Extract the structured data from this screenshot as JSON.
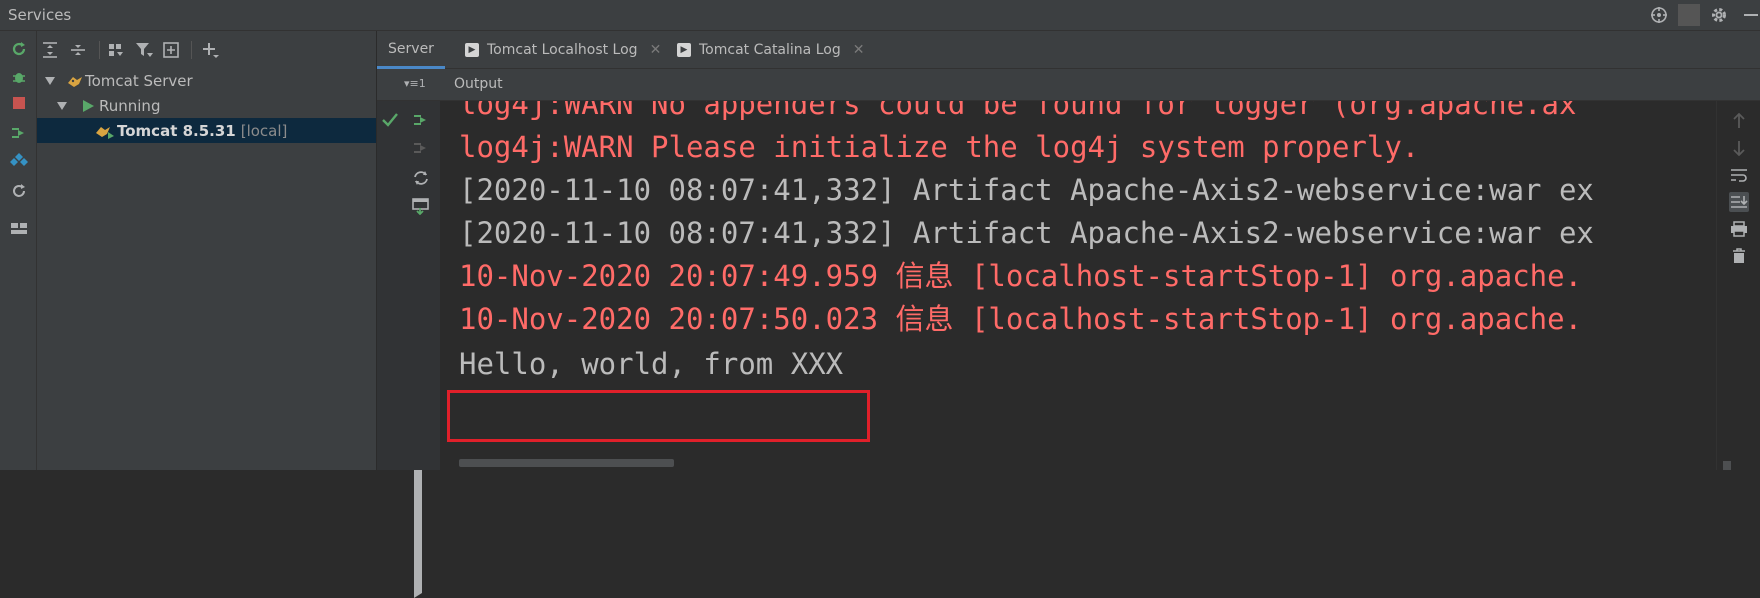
{
  "window": {
    "title": "Services"
  },
  "colors": {
    "accent": "#4a88c7",
    "error_text": "#ff6b68",
    "normal_text": "#bbbbbb",
    "highlight_box": "#e0202a",
    "selection": "#0d293e"
  },
  "tree": {
    "nodes": [
      {
        "label": "Tomcat Server",
        "icon": "tomcat-icon",
        "expanded": true
      },
      {
        "label": "Running",
        "icon": "run-icon",
        "expanded": true
      },
      {
        "label": "Tomcat 8.5.31",
        "suffix": "[local]",
        "icon": "tomcat-icon",
        "expanded": false,
        "selected": true
      }
    ]
  },
  "tabs": [
    {
      "label": "Server",
      "active": true
    },
    {
      "label": "Tomcat Localhost Log",
      "icon": "console-icon",
      "closable": true
    },
    {
      "label": "Tomcat Catalina Log",
      "icon": "console-icon",
      "closable": true
    }
  ],
  "output": {
    "header": "Output",
    "selector": "1",
    "lines": [
      {
        "text": "log4j:WARN No appenders could be found for logger (org.apache.ax",
        "kind": "error"
      },
      {
        "text": "log4j:WARN Please initialize the log4j system properly.",
        "kind": "error"
      },
      {
        "text": "[2020-11-10 08:07:41,332] Artifact Apache-Axis2-webservice:war ex",
        "kind": "normal"
      },
      {
        "text": "[2020-11-10 08:07:41,332] Artifact Apache-Axis2-webservice:war ex",
        "kind": "normal"
      },
      {
        "text": "10-Nov-2020 20:07:49.959 信息 [localhost-startStop-1] org.apache.",
        "kind": "error"
      },
      {
        "text": "10-Nov-2020 20:07:50.023 信息 [localhost-startStop-1] org.apache.",
        "kind": "error"
      },
      {
        "text": "Hello, world, from XXX",
        "kind": "normal",
        "highlighted": true
      }
    ]
  }
}
